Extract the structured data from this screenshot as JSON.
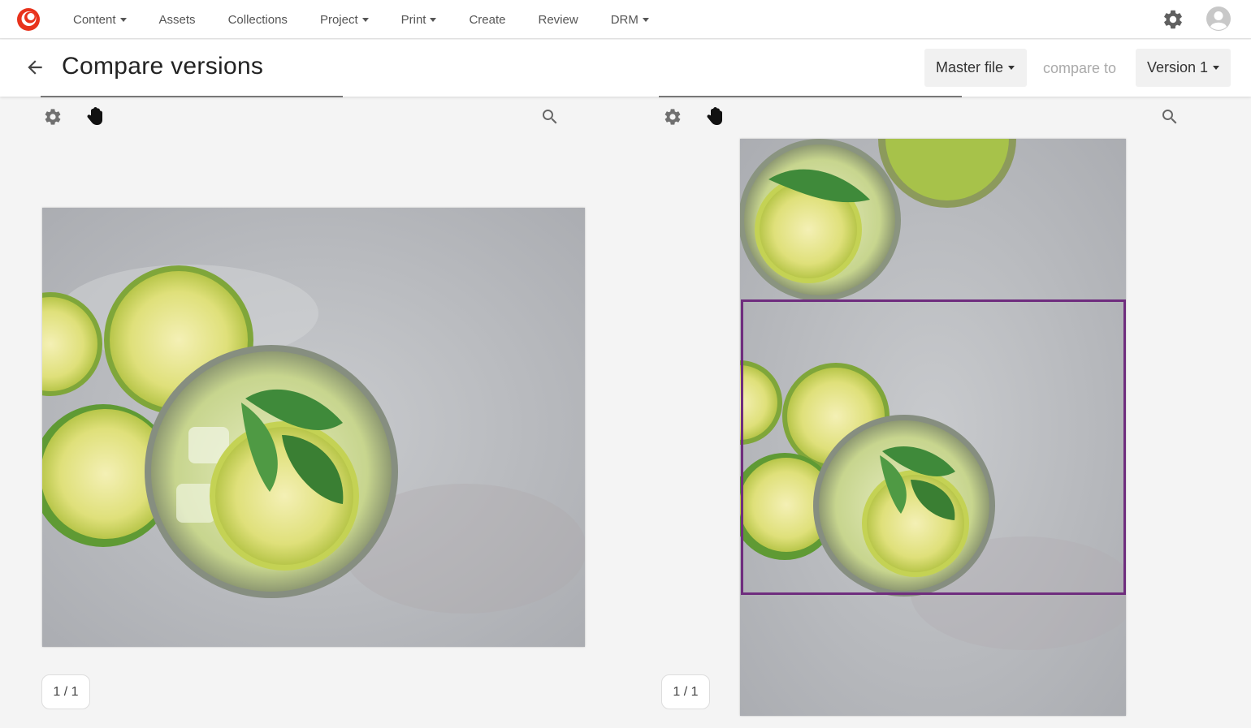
{
  "nav": {
    "logo_icon": "brand-logo-icon",
    "items": [
      {
        "label": "Content",
        "has_caret": true
      },
      {
        "label": "Assets",
        "has_caret": false
      },
      {
        "label": "Collections",
        "has_caret": false
      },
      {
        "label": "Project",
        "has_caret": true
      },
      {
        "label": "Print",
        "has_caret": true
      },
      {
        "label": "Create",
        "has_caret": false
      },
      {
        "label": "Review",
        "has_caret": false
      },
      {
        "label": "DRM",
        "has_caret": true
      }
    ],
    "settings_icon": "gear-icon",
    "user_icon": "user-avatar-icon"
  },
  "header": {
    "title": "Compare versions",
    "back_icon": "arrow-left-icon",
    "master_label": "Master file",
    "compare_label": "compare to",
    "version_label": "Version 1"
  },
  "left_viewer": {
    "tools": [
      "gear-icon",
      "hand-icon",
      "search-icon"
    ],
    "page_counter": "1 / 1"
  },
  "right_viewer": {
    "tools": [
      "gear-icon",
      "hand-icon",
      "search-icon"
    ],
    "page_counter": "1 / 1",
    "highlight_color": "#6f2d7e"
  },
  "colors": {
    "brand": "#e8321c",
    "highlight": "#6f2d7e",
    "lime": "#d8e06a",
    "mint": "#3f8a3a"
  }
}
